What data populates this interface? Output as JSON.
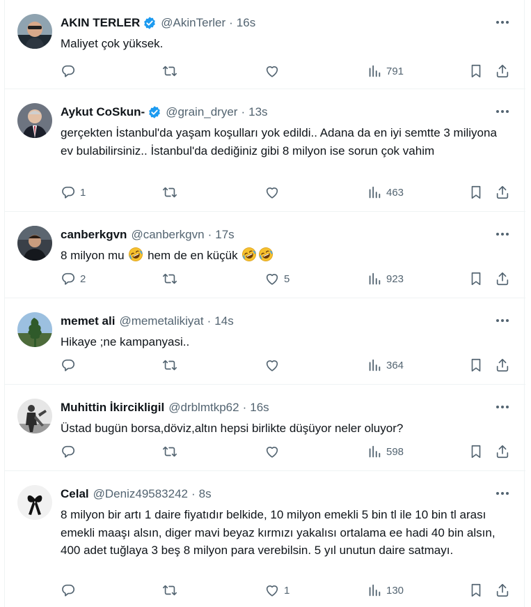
{
  "tweets": [
    {
      "name": "AKIN TERLER",
      "verified": true,
      "handle": "@AkinTerler",
      "time": "16s",
      "text": "Maliyet çok yüksek.",
      "replies": "",
      "reposts": "",
      "likes": "",
      "views": "791"
    },
    {
      "name": "Aykut CoSkun-",
      "verified": true,
      "handle": "@grain_dryer",
      "time": "13s",
      "text": "gerçekten İstanbul'da yaşam koşulları yok edildi.. Adana da  en iyi semtte 3 miliyona ev bulabilirsiniz.. İstanbul'da  dediğiniz gibi 8 milyon ise sorun çok vahim",
      "replies": "1",
      "reposts": "",
      "likes": "",
      "views": "463"
    },
    {
      "name": "canberkgvn",
      "verified": false,
      "handle": "@canberkgvn",
      "time": "17s",
      "text_a": "8 milyon mu ",
      "text_b": " hem de en küçük ",
      "replies": "2",
      "reposts": "",
      "likes": "5",
      "views": "923"
    },
    {
      "name": "memet ali",
      "verified": false,
      "handle": "@memetalikiyat",
      "time": "14s",
      "text": "Hikaye ;ne kampanyasi..",
      "replies": "",
      "reposts": "",
      "likes": "",
      "views": "364"
    },
    {
      "name": "Muhittin İkircikligil",
      "verified": false,
      "handle": "@drblmtkp62",
      "time": "16s",
      "text": "Üstad bugün borsa,döviz,altın hepsi birlikte düşüyor neler oluyor?",
      "replies": "",
      "reposts": "",
      "likes": "",
      "views": "598"
    },
    {
      "name": "Celal",
      "verified": false,
      "handle": "@Deniz49583242",
      "time": "8s",
      "text": "8 milyon bir artı 1 daire fiyatıdır belkide, 10 milyon emekli 5 bin tl ile 10 bin tl arası emekli maaşı alsın, diger mavi beyaz kırmızı yakalısı ortalama ee hadi 40 bin alsın, 400 adet tuğlaya 3 beş 8 milyon para verebilsin. 5 yıl unutun daire satmayı.",
      "replies": "",
      "reposts": "",
      "likes": "1",
      "views": "130"
    }
  ],
  "colors": {
    "text": "#0f1419",
    "muted": "#536471",
    "verified": "#1d9bf0",
    "divider": "#eff3f4"
  },
  "icons": [
    "reply-icon",
    "repost-icon",
    "like-icon",
    "views-icon",
    "bookmark-icon",
    "share-icon",
    "more-icon",
    "verified-badge-icon",
    "rofl-emoji"
  ],
  "separator": "·"
}
